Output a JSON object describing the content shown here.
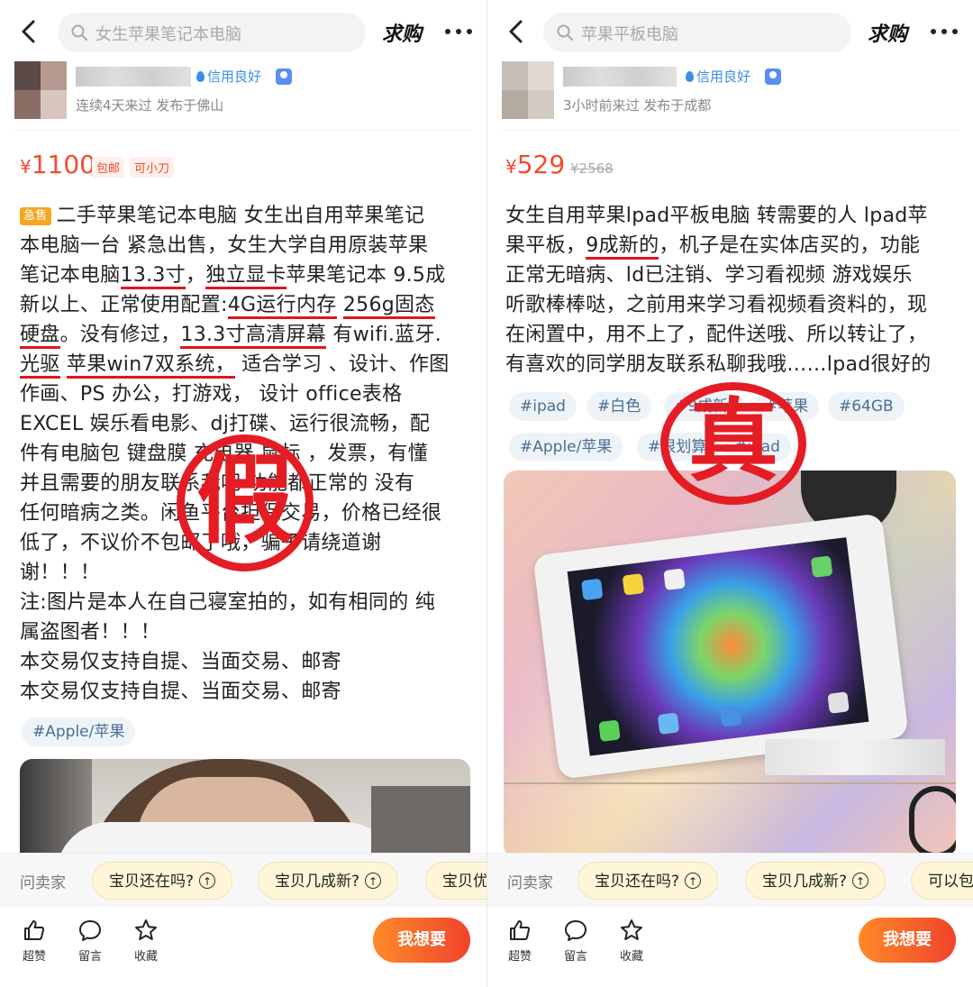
{
  "left": {
    "search_text": "女生苹果笔记本电脑",
    "want_label": "求购",
    "credit": "信用良好",
    "seller_sub": "连续4天来过  发布于佛山",
    "price": {
      "yen": "¥",
      "num": "1100",
      "tags": [
        "包邮",
        "可小刀"
      ]
    },
    "urgent": "急售",
    "stamp": "假",
    "lines": [
      [
        "二手苹果笔记本电脑 女生出自用苹果笔记"
      ],
      [
        "本电脑一台  紧急出售，女生大学自用原装苹果"
      ],
      [
        "笔记本电脑",
        "13.3寸",
        "，",
        "独立显卡",
        "苹果笔记本 9.5成"
      ],
      [
        "新以上、正常使用配置:",
        "4G运行内存",
        " ",
        "256g固态"
      ],
      [
        "硬盘",
        "。没有修过，",
        "13.3寸高清屏幕",
        " 有wifi.蓝牙."
      ],
      [
        "光驱",
        " ",
        "苹果win7双系统，",
        " 适合学习 、设计、作图"
      ],
      [
        "作画、PS  办公，打游戏，  设计   office表格"
      ],
      [
        "EXCEL 娱乐看电影、dj打碟、运行很流畅，配"
      ],
      [
        "件有电脑包  键盘膜  充电器  鼠标 ，发票，有懂"
      ],
      [
        "并且需要的朋友联系我吧 功能都正常的  没有"
      ],
      [
        "任何暗病之类。闲鱼平台担保交易，价格已经很"
      ],
      [
        "低了，不议价不包邮了哦，骗子请绕道谢"
      ],
      [
        "谢！！！"
      ],
      [
        "注:图片是本人在自己寝室拍的，如有相同的  纯"
      ],
      [
        "属盗图者！！！"
      ],
      [
        "本交易仅支持自提、当面交易、邮寄"
      ],
      [
        "本交易仅支持自提、当面交易、邮寄"
      ]
    ],
    "hashtags": [
      "#Apple/苹果"
    ],
    "ask_label": "问卖家",
    "ask_chips": [
      "宝贝还在吗?",
      "宝贝几成新?",
      "宝贝优"
    ],
    "actions": [
      "超赞",
      "留言",
      "收藏"
    ],
    "cta": "我想要"
  },
  "right": {
    "search_text": "苹果平板电脑",
    "want_label": "求购",
    "credit": "信用良好",
    "seller_sub": "3小时前来过  发布于成都",
    "price": {
      "yen": "¥",
      "num": "529",
      "original": "¥2568"
    },
    "stamp": "真",
    "lines": [
      [
        "女生自用苹果lpad平板电脑  转需要的人  lpad苹"
      ],
      [
        "果平板，",
        "9成新的",
        "，机子是在实体店买的，功能"
      ],
      [
        "正常无暗病、ld已注销、学习看视频  游戏娱乐"
      ],
      [
        "听歌棒棒哒，之前用来学习看视频看资料的，现"
      ],
      [
        "在闲置中，用不上了，配件送哦、所以转让了，"
      ],
      [
        "有喜欢的同学朋友联系私聊我哦……lpad很好的"
      ]
    ],
    "hashtags": [
      "#ipad",
      "#白色",
      "#9成新",
      "#苹果",
      "#64GB",
      "#Apple/苹果",
      "#很划算",
      "#ipad"
    ],
    "ask_label": "问卖家",
    "ask_chips": [
      "宝贝还在吗?",
      "宝贝几成新?",
      "可以包"
    ],
    "actions": [
      "超赞",
      "留言",
      "收藏"
    ],
    "cta": "我想要"
  },
  "colors": {
    "accent": "#f24a2c",
    "stamp": "#e41d24",
    "link": "#3a8ee6",
    "cta_start": "#ff8a2a",
    "cta_end": "#f0432a"
  },
  "icons": [
    "back-arrow-icon",
    "search-icon",
    "more-icon",
    "credit-drop-icon",
    "id-badge-icon",
    "thumb-up-icon",
    "comment-icon",
    "star-icon",
    "arrow-up-icon"
  ]
}
